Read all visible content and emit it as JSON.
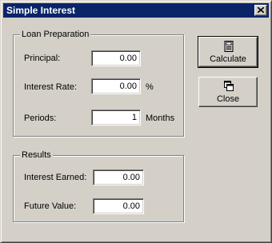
{
  "window": {
    "title": "Simple Interest",
    "close_icon": "close-icon"
  },
  "loan_preparation": {
    "title": "Loan Preparation",
    "principal": {
      "label": "Principal:",
      "value": "0.00"
    },
    "interest_rate": {
      "label": "Interest Rate:",
      "value": "0.00",
      "unit": "%"
    },
    "periods": {
      "label": "Periods:",
      "value": "1",
      "unit": "Months"
    }
  },
  "results": {
    "title": "Results",
    "interest_earned": {
      "label": "Interest Earned:",
      "value": "0.00"
    },
    "future_value": {
      "label": "Future Value:",
      "value": "0.00"
    }
  },
  "buttons": {
    "calculate": {
      "label": "Calculate",
      "icon": "calculator-icon"
    },
    "close": {
      "label": "Close",
      "icon": "windows-icon"
    }
  },
  "colors": {
    "titlebar": "#0a246a",
    "face": "#d4d0c8"
  }
}
